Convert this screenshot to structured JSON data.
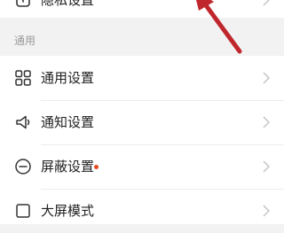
{
  "top_item": {
    "label": "隐私设置",
    "icon": "lock-icon"
  },
  "section": {
    "header": "通用"
  },
  "items": [
    {
      "label": "通用设置",
      "icon": "grid-icon",
      "has_dot": false
    },
    {
      "label": "通知设置",
      "icon": "speaker-icon",
      "has_dot": false
    },
    {
      "label": "屏蔽设置",
      "icon": "minus-circle-icon",
      "has_dot": true
    },
    {
      "label": "大屏模式",
      "icon": "square-icon",
      "has_dot": false
    }
  ],
  "colors": {
    "background": "#f2f2f2",
    "card": "#ffffff",
    "text": "#222222",
    "muted": "#999999",
    "dot": "#e84a1f",
    "annotation_arrow": "#c0272d"
  }
}
